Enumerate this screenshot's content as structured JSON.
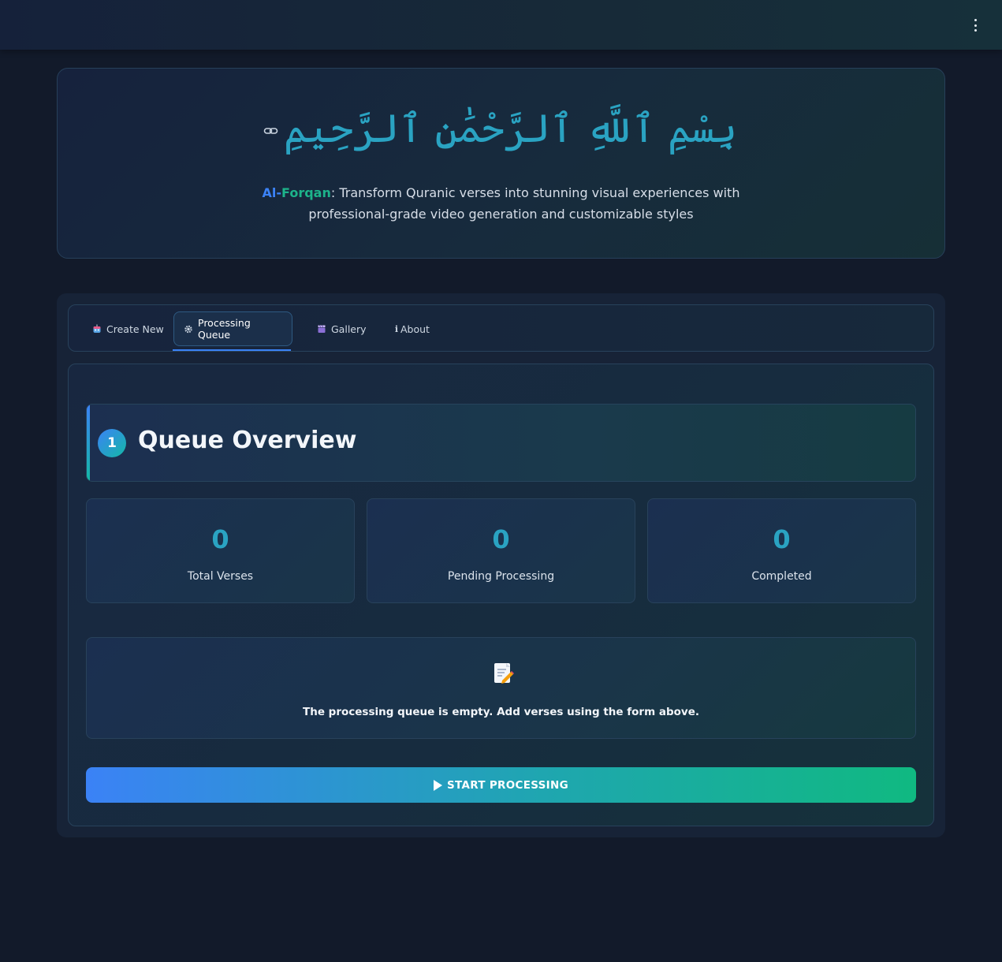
{
  "header": {
    "menu_icon": "more-vertical-icon"
  },
  "hero": {
    "basmala": "بِسْمِ ٱللَّهِ ٱلرَّحْمَٰنِ ٱلرَّحِيمِ",
    "brand_part1": "Al-",
    "brand_part2": "Forqan",
    "tagline_line1": ": Transform Quranic verses into stunning visual experiences with",
    "tagline_line2": "professional-grade video generation and customizable styles",
    "link_icon": "link-icon"
  },
  "tabs": [
    {
      "label": "Create New",
      "icon": "robot-icon"
    },
    {
      "label": "Processing Queue",
      "icon": "gear-icon",
      "active": true
    },
    {
      "label": "Gallery",
      "icon": "clapper-icon"
    },
    {
      "label": "About",
      "icon": "info-icon"
    }
  ],
  "section": {
    "step": "1",
    "title": "Queue Overview"
  },
  "stats": [
    {
      "value": "0",
      "label": "Total Verses"
    },
    {
      "value": "0",
      "label": "Pending Processing"
    },
    {
      "value": "0",
      "label": "Completed"
    }
  ],
  "empty_state": {
    "icon": "memo-icon",
    "message": "The processing queue is empty. Add verses using the form above."
  },
  "actions": {
    "start_label": "START PROCESSING"
  },
  "colors": {
    "accent_blue": "#3b82f6",
    "accent_green": "#10b981",
    "teal_text": "#2aa3c2",
    "background": "#121a2a"
  }
}
